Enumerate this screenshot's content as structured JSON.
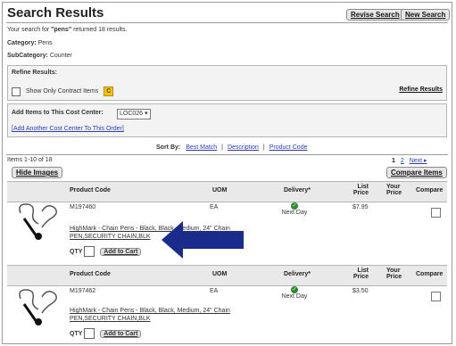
{
  "header": {
    "title": "Search Results",
    "revise_label": "Revise Search",
    "new_label": "New Search"
  },
  "info": {
    "prefix": "Your search for ",
    "term": "\"pens\"",
    "suffix": " returned 18 results.",
    "category_label": "Category:",
    "category_value": "Pens",
    "subcategory_label": "SubCategory:",
    "subcategory_value": "Counter"
  },
  "refine": {
    "title": "Refine Results:",
    "contract_label": "Show Only Contract Items",
    "contract_icon": "C",
    "refine_button": "Refine Results"
  },
  "cost_center": {
    "label": "Add Items to This Cost Center:",
    "selected": "LOC026",
    "add_link": "[Add Another Cost Center To This Order]"
  },
  "sort": {
    "label": "Sort By:",
    "options": [
      "Best Match",
      "Description",
      "Product Code"
    ],
    "sep": "|"
  },
  "pagination": {
    "items_text": "Items 1-10 of 18",
    "page_current": "1",
    "page_next_num": "2",
    "next_label": "Next ▸"
  },
  "actions": {
    "hide_images": "Hide Images",
    "compare_items": "Compare Items"
  },
  "columns": {
    "product_code": "Product Code",
    "uom": "UOM",
    "delivery": "Delivery*",
    "list_price": "List Price",
    "your_price": "Your Price",
    "compare": "Compare"
  },
  "products": [
    {
      "code": "M197460",
      "uom": "EA",
      "delivery": "Next Day",
      "list_price": "$7.95",
      "your_price": "",
      "desc_line1": "HighMark - Chain Pens - Black, Black, Medium, 24\" Chain",
      "desc_line2": "PEN,SECURITY CHAIN,BLK",
      "qty_label": "QTY",
      "cart_label": "Add to Cart"
    },
    {
      "code": "M197462",
      "uom": "EA",
      "delivery": "Next Day",
      "list_price": "$3.50",
      "your_price": "",
      "desc_line1": "HighMark - Chain Pens - Black, Black, Medium, 24\" Chain",
      "desc_line2": "PEN,SECURITY CHAIN,BLK",
      "qty_label": "QTY",
      "cart_label": "Add to Cart"
    }
  ],
  "colors": {
    "link": "#2a3dbb",
    "arrow": "#1a2b8c",
    "contract_icon": "#f3c400",
    "delivery_check": "#2f8a2f"
  },
  "icons": {
    "product_image": "pen-on-chain-icon",
    "delivery": "check-circle-icon",
    "annotation": "arrow-left-icon"
  }
}
